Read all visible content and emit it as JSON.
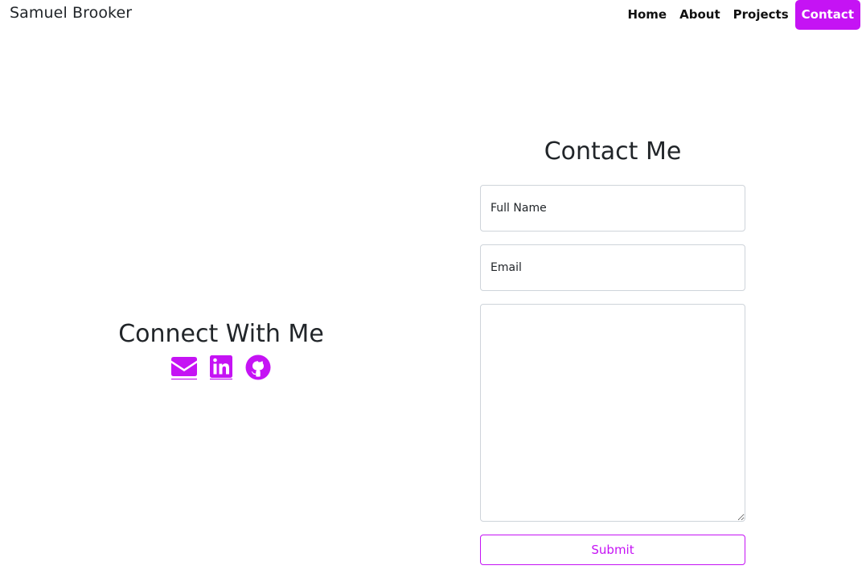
{
  "navbar": {
    "brand": "Samuel Brooker",
    "links": [
      {
        "label": "Home"
      },
      {
        "label": "About"
      },
      {
        "label": "Projects"
      },
      {
        "label": "Contact",
        "active": true
      }
    ]
  },
  "connect": {
    "title": "Connect With Me",
    "icons": [
      "envelope-icon",
      "linkedin-icon",
      "github-icon"
    ]
  },
  "contact": {
    "title": "Contact Me",
    "name_placeholder": "Full Name",
    "email_placeholder": "Email",
    "message_placeholder": "",
    "submit_label": "Submit"
  },
  "colors": {
    "accent": "#c513f4",
    "text": "#212529",
    "border": "#ced4da"
  }
}
